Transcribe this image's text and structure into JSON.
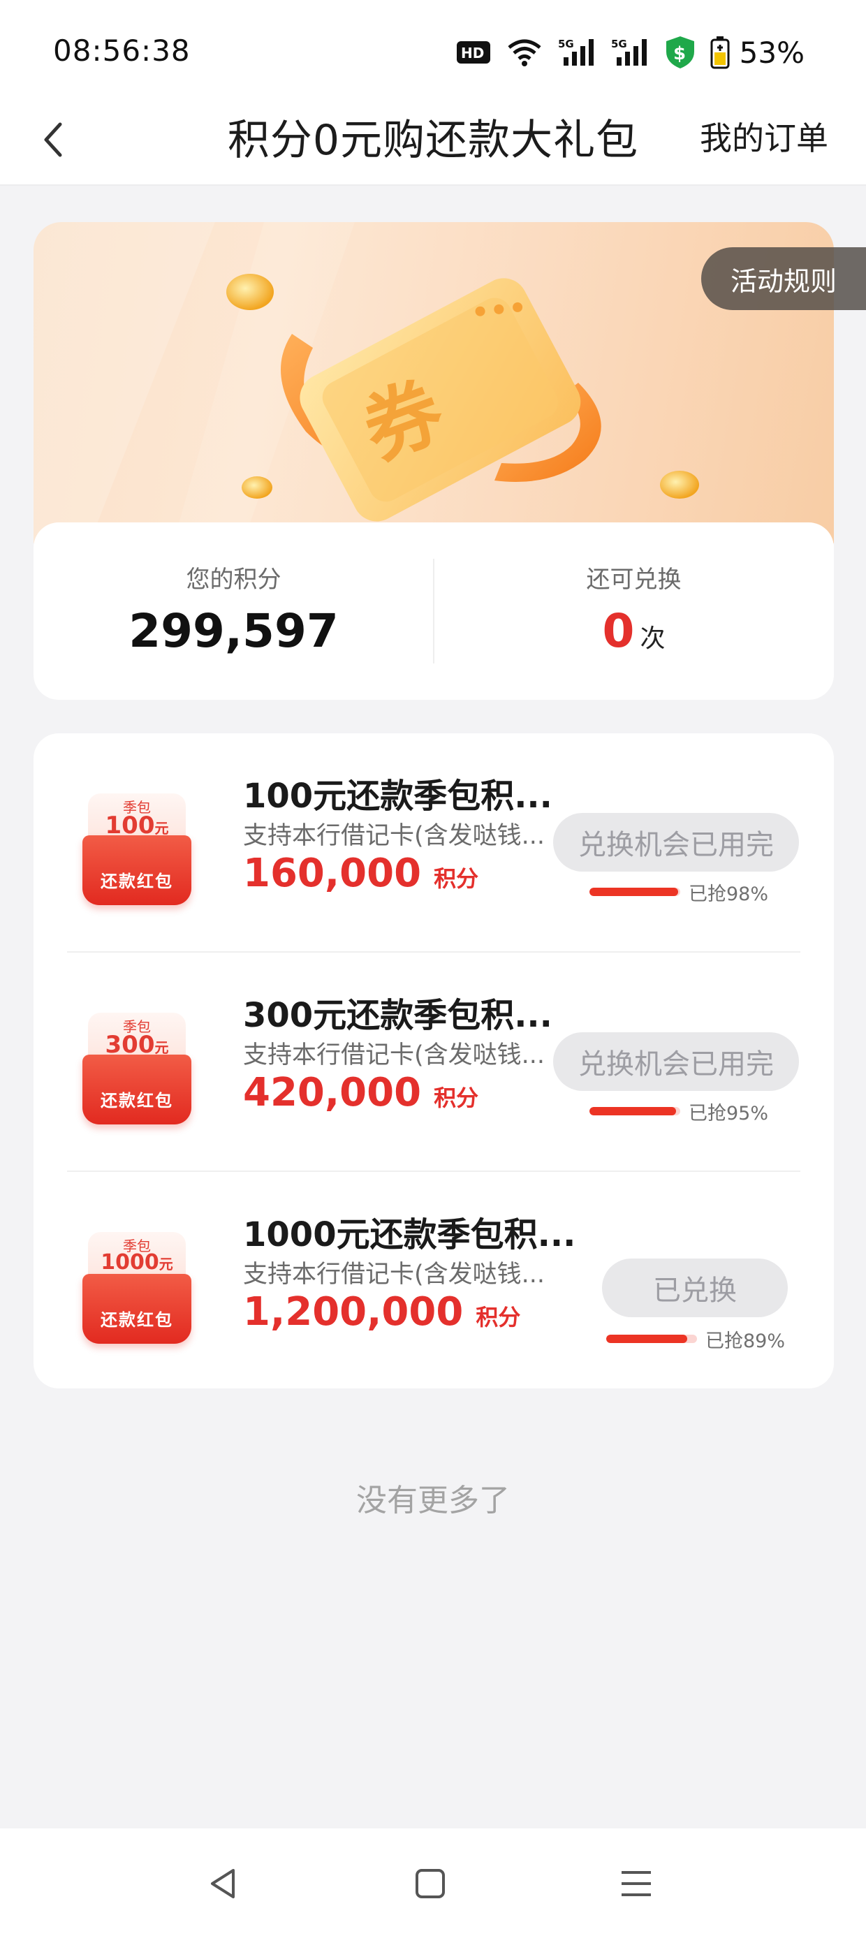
{
  "status_bar": {
    "time": "08:56:38",
    "battery_percent": "53%",
    "icons": [
      "hd-icon",
      "wifi-icon",
      "signal-5g-icon",
      "signal-5g-icon",
      "shield-dollar-icon",
      "battery-icon"
    ]
  },
  "nav": {
    "title": "积分0元购还款大礼包",
    "my_orders": "我的订单"
  },
  "hero": {
    "rules_label": "活动规则",
    "coupon_char": "券"
  },
  "points": {
    "label": "您的积分",
    "value": "299,597",
    "redeem_label": "还可兑换",
    "redeem_count": "0",
    "redeem_unit": "次"
  },
  "items": [
    {
      "thumb_tag": "季包",
      "thumb_amount": "100",
      "thumb_unit": "元",
      "thumb_label": "还款红包",
      "title": "100元还款季包积...",
      "desc": "支持本行借记卡(含发哒钱...",
      "price": "160,000",
      "price_unit": "积分",
      "button": "兑换机会已用完",
      "progress_text": "已抢98%",
      "progress": 0.98
    },
    {
      "thumb_tag": "季包",
      "thumb_amount": "300",
      "thumb_unit": "元",
      "thumb_label": "还款红包",
      "title": "300元还款季包积...",
      "desc": "支持本行借记卡(含发哒钱...",
      "price": "420,000",
      "price_unit": "积分",
      "button": "兑换机会已用完",
      "progress_text": "已抢95%",
      "progress": 0.95
    },
    {
      "thumb_tag": "季包",
      "thumb_amount": "1000",
      "thumb_unit": "元",
      "thumb_label": "还款红包",
      "title": "1000元还款季包积...",
      "desc": "支持本行借记卡(含发哒钱...",
      "price": "1,200,000",
      "price_unit": "积分",
      "button": "已兑换",
      "progress_text": "已抢89%",
      "progress": 0.89
    }
  ],
  "footer": {
    "no_more": "没有更多了"
  },
  "colors": {
    "accent_red": "#e4302c",
    "rules_bg": "#504a46",
    "disabled_button_bg": "#e8e8ea"
  }
}
